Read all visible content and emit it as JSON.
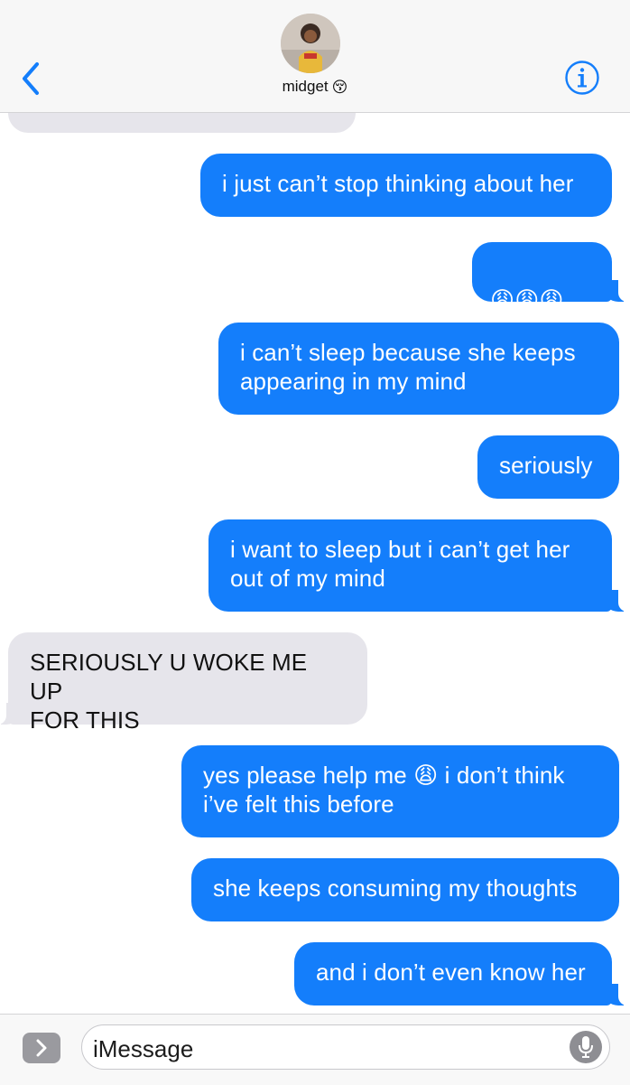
{
  "header": {
    "contact_name": "midget",
    "contact_emoji": "😚",
    "back_icon": "chevron-left-icon",
    "info_icon": "info-icon",
    "accent_color": "#147efb"
  },
  "messages": [
    {
      "from": "them",
      "text": "",
      "clipped": true
    },
    {
      "from": "me",
      "text": "i just can’t stop thinking about her"
    },
    {
      "from": "me",
      "text": "😩😩😩",
      "emoji_only": true
    },
    {
      "from": "me",
      "text": "i can’t sleep because she keeps\nappearing in my mind"
    },
    {
      "from": "me",
      "text": "seriously"
    },
    {
      "from": "me",
      "text": "i want to sleep but i can’t get her\nout of my mind"
    },
    {
      "from": "them",
      "text": "SERIOUSLY U WOKE ME UP\nFOR THIS"
    },
    {
      "from": "me",
      "text": "yes please help me 😩 i don’t think\ni’ve felt this before"
    },
    {
      "from": "me",
      "text": "she keeps consuming my thoughts"
    },
    {
      "from": "me",
      "text": "and i don’t even know her"
    }
  ],
  "input": {
    "placeholder": "iMessage",
    "apps_icon": "chevron-right-icon",
    "mic_icon": "microphone-icon"
  },
  "colors": {
    "sent_bubble": "#147efb",
    "received_bubble": "#e6e5eb",
    "header_bg": "#f7f7f7"
  }
}
